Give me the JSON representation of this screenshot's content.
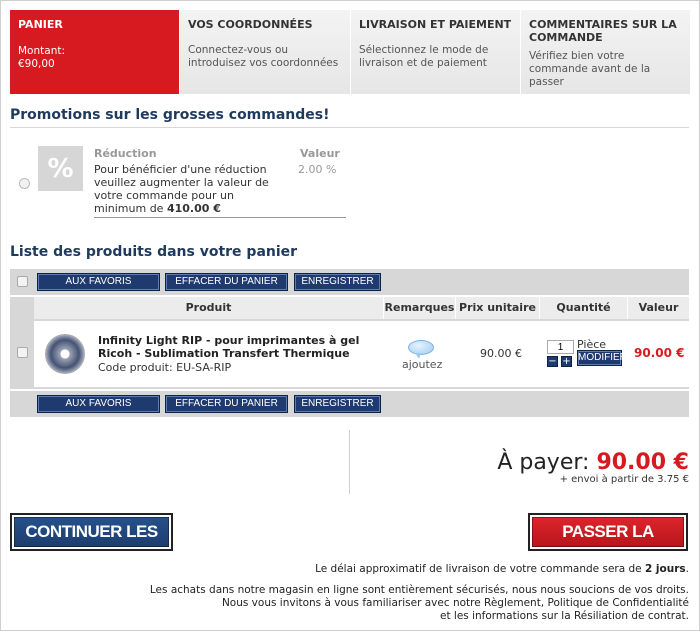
{
  "steps": [
    {
      "title": "PANIER",
      "desc1": "Montant:",
      "desc2": "€90,00"
    },
    {
      "title": "VOS COORDONNÉES",
      "desc1": "Connectez-vous ou",
      "desc2": "introduisez vos coordonnées"
    },
    {
      "title": "LIVRAISON ET PAIEMENT",
      "desc1": "Sélectionnez le mode de",
      "desc2": "livraison et de paiement"
    },
    {
      "title1": "COMMENTAIRES SUR LA",
      "title2": "COMMANDE",
      "desc1": "Vérifiez bien votre",
      "desc2": "commande avant de la",
      "desc3": "passer"
    }
  ],
  "promotions": {
    "heading": "Promotions sur les grosses commandes!",
    "icon_symbol": "%",
    "col_reduction": "Réduction",
    "col_valeur": "Valeur",
    "text_line1": "Pour bénéficier d'une réduction",
    "text_line2": "veuillez augmenter la valeur de",
    "text_line3": "votre commande pour un",
    "text_line4_prefix": "minimum de ",
    "minimum": "410.00 €",
    "value": "2.00 %"
  },
  "cart": {
    "heading": "Liste des produits dans votre panier",
    "buttons": {
      "favoris": "AUX FAVORIS",
      "effacer": "EFFACER DU PANIER",
      "enregistrer": "ENREGISTRER"
    },
    "columns": {
      "produit": "Produit",
      "remarques": "Remarques",
      "prix": "Prix unitaire",
      "quantite": "Quantité",
      "valeur": "Valeur"
    },
    "item": {
      "name_line1": "Infinity Light RIP - pour imprimantes à gel",
      "name_line2": "Ricoh - Sublimation Transfert Thermique",
      "code": "Code produit: EU-SA-RIP",
      "remark": "ajoutez",
      "unit_price": "90.00 €",
      "qty": "1",
      "unit": "Pièce",
      "minus": "−",
      "plus": "+",
      "modify": "MODIFIER",
      "value": "90.00 €"
    }
  },
  "totals": {
    "label": "À payer:",
    "amount": "90.00 €",
    "shipping": "+ envoi à partir de 3.75 €"
  },
  "actions": {
    "continue": "CONTINUER LES ACHATS",
    "order": "PASSER LA COMMANDE"
  },
  "info": {
    "delay_prefix": "Le délai approximatif de livraison de votre commande sera de ",
    "delay_value": "2 jours",
    "delay_suffix": ".",
    "secure_line1": "Les achats dans notre magasin en ligne sont entièrement sécurisés, nous nous soucions de vos droits.",
    "secure_line2": "Nous vous invitons à vous familiariser avec notre Règlement, Politique de Confidentialité",
    "secure_line3": "et les informations sur la Résiliation de contrat."
  },
  "colors": {
    "accent_red": "#d71920",
    "navy": "#1f3a6e",
    "heading_blue": "#1f3a5c"
  }
}
